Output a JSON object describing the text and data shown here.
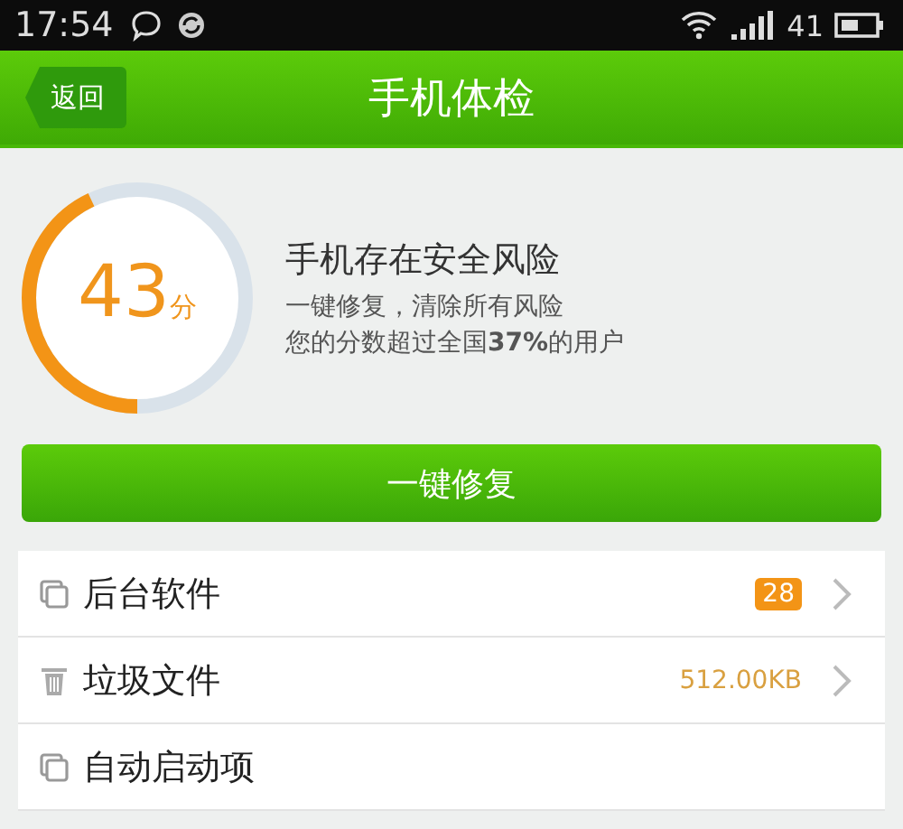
{
  "status_bar": {
    "time": "17:54",
    "battery": "41"
  },
  "header": {
    "back": "返回",
    "title": "手机体检"
  },
  "score": {
    "value": "43",
    "unit": "分",
    "level": 0.43,
    "headline": "手机存在安全风险",
    "line_1": "一键修复，清除所有风险",
    "line_2": "您的分数超过全国**37%**的用户"
  },
  "fix_button": "一键修复",
  "items": [
    {
      "label": "后台软件",
      "kind": "badge",
      "value": "28"
    },
    {
      "label": "垃圾文件",
      "kind": "size",
      "value": "512.00KB"
    },
    {
      "label": "自动启动项",
      "kind": "plain"
    }
  ]
}
